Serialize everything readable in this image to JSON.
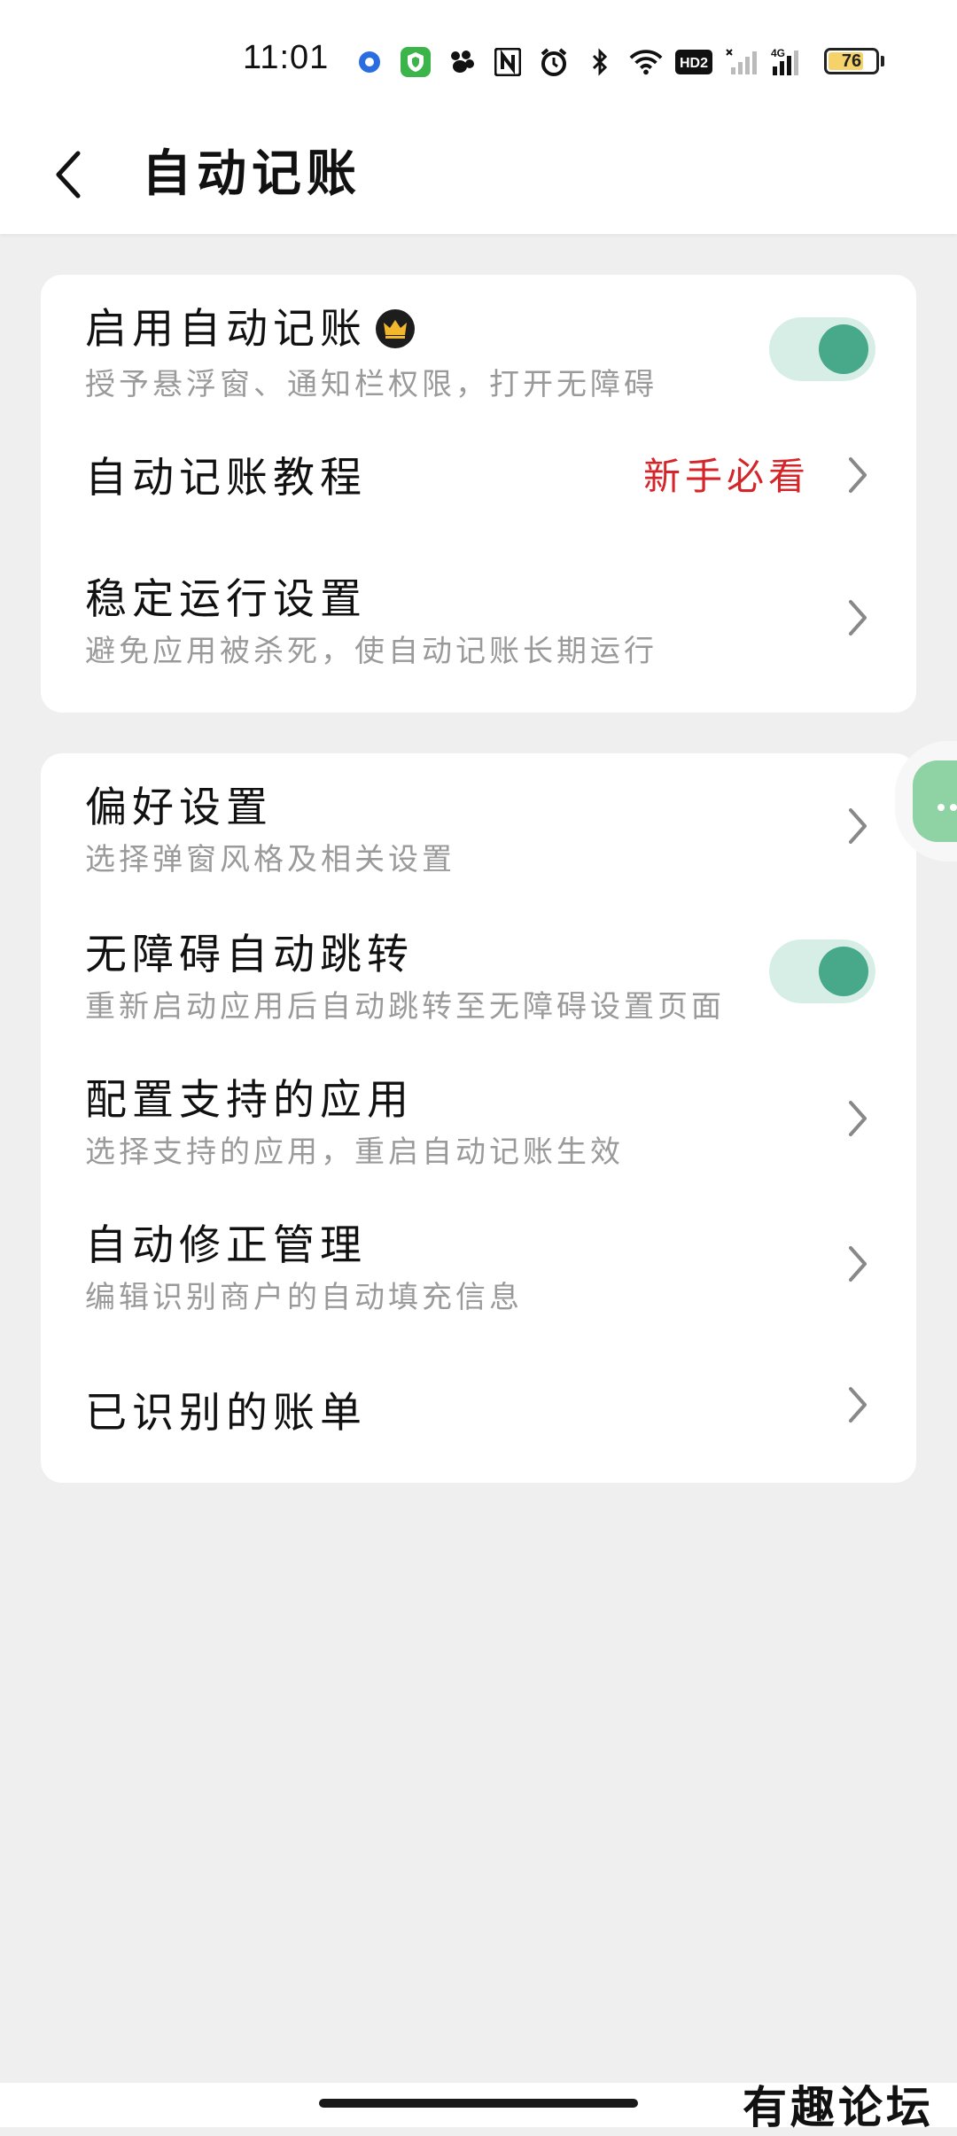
{
  "status_bar": {
    "time": "11:01",
    "icons": [
      "app-ring-icon",
      "shield-app-icon",
      "paw-icon",
      "nfc-icon",
      "alarm-icon",
      "bluetooth-icon",
      "wifi-icon",
      "hd-icon",
      "signal-x-icon",
      "signal-4g-icon"
    ],
    "hd_label": "HD2",
    "network_label": "4G",
    "battery_level": "76"
  },
  "header": {
    "title": "自动记账"
  },
  "card1": {
    "enable": {
      "title": "启用自动记账",
      "subtitle": "授予悬浮窗、通知栏权限，打开无障碍",
      "toggle_on": true
    },
    "tutorial": {
      "title": "自动记账教程",
      "tag": "新手必看"
    },
    "stable": {
      "title": "稳定运行设置",
      "subtitle": "避免应用被杀死，使自动记账长期运行"
    }
  },
  "card2": {
    "preference": {
      "title": "偏好设置",
      "subtitle": "选择弹窗风格及相关设置"
    },
    "accessibility_jump": {
      "title": "无障碍自动跳转",
      "subtitle": "重新启动应用后自动跳转至无障碍设置页面",
      "toggle_on": true
    },
    "supported_apps": {
      "title": "配置支持的应用",
      "subtitle": "选择支持的应用，重启自动记账生效"
    },
    "auto_fix": {
      "title": "自动修正管理",
      "subtitle": "编辑识别商户的自动填充信息"
    },
    "recognized_bills": {
      "title": "已识别的账单"
    }
  },
  "watermark": "有趣论坛",
  "colors": {
    "accent": "#47a88a",
    "toggle_track": "#d6eee6",
    "tag_red": "#d4262a",
    "subtitle_gray": "#9a9a9a",
    "page_bg": "#efefef"
  }
}
